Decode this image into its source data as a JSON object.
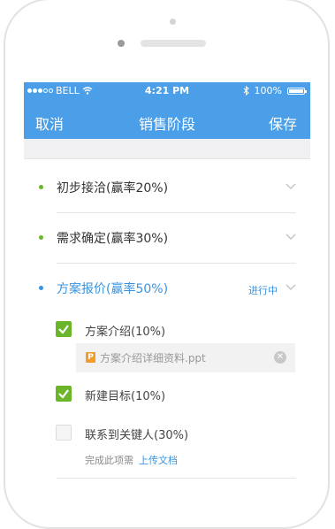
{
  "status_bar": {
    "carrier": "BELL",
    "time": "4:21 PM",
    "battery": "100%"
  },
  "nav": {
    "cancel_label": "取消",
    "title": "销售阶段",
    "save_label": "保存"
  },
  "stages": [
    {
      "label": "初步接洽(赢率20%)",
      "bullet_color": "#6bb52b"
    },
    {
      "label": "需求确定(赢率30%)",
      "bullet_color": "#6bb52b"
    },
    {
      "label": "方案报价(赢率50%)",
      "bullet_color": "#3a93de",
      "status": "进行中"
    }
  ],
  "tasks": [
    {
      "label": "方案介绍(10%)",
      "checked": true
    },
    {
      "label": "新建目标(10%)",
      "checked": true
    },
    {
      "label": "联系到关键人(30%)",
      "checked": false
    }
  ],
  "attachment": {
    "icon_letter": "P",
    "filename": "方案介绍详细资料.ppt"
  },
  "hint": {
    "text": "完成此项需",
    "link": "上传文档"
  },
  "colors": {
    "nav_bar": "#4a9fe8",
    "done_green": "#6bb52b",
    "active_blue": "#3a93de"
  }
}
